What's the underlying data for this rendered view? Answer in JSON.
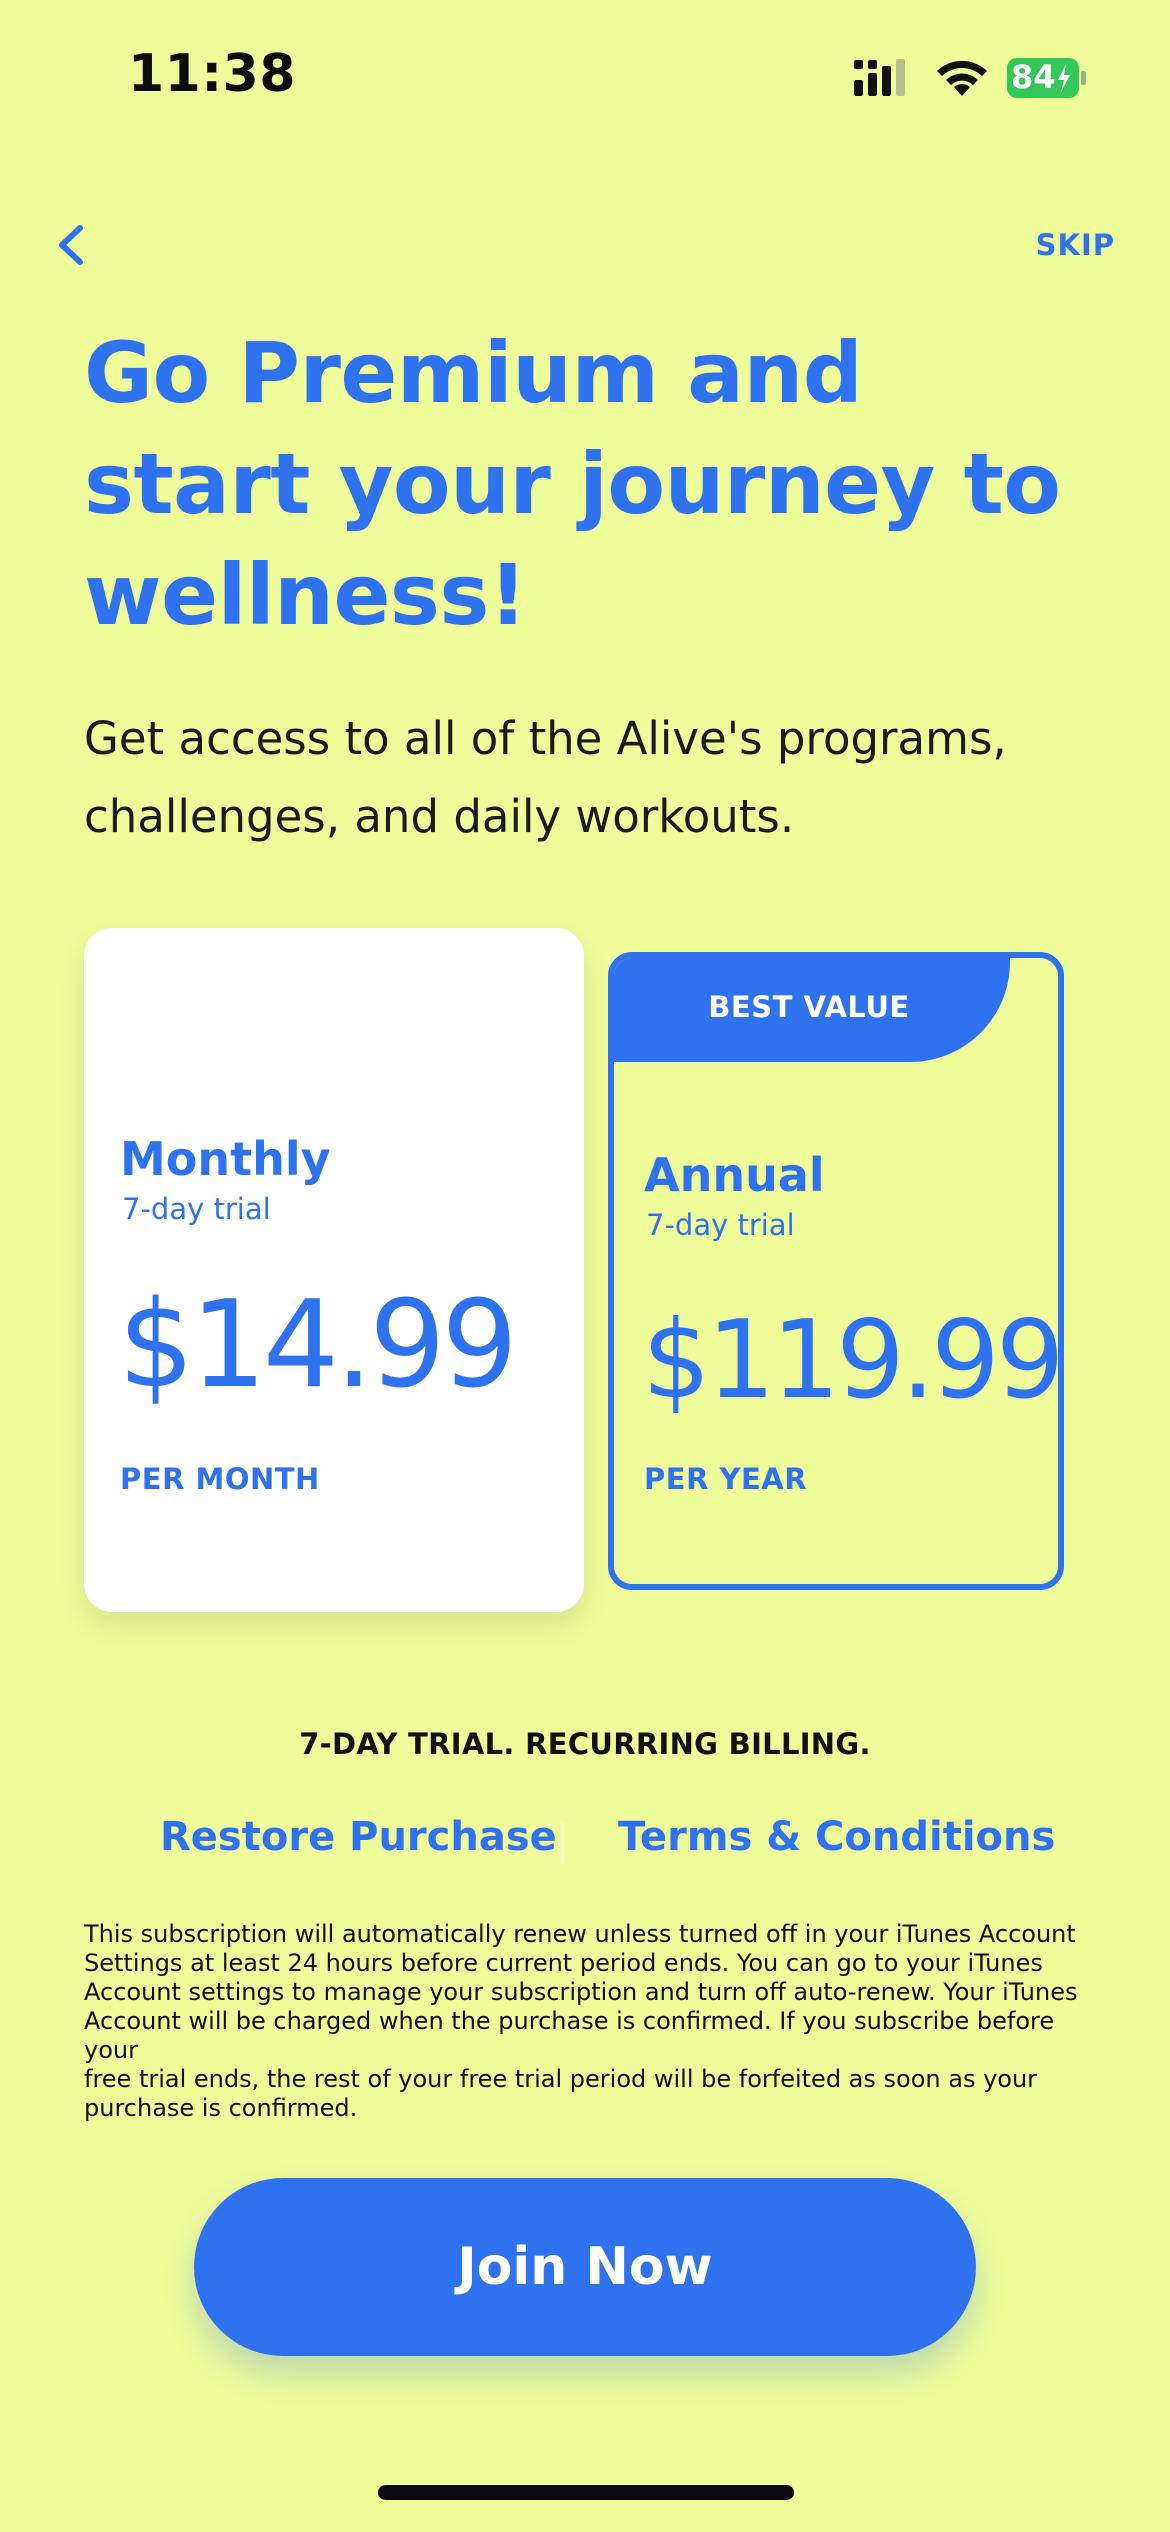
{
  "status_bar": {
    "time": "11:38",
    "battery_level": "84"
  },
  "nav": {
    "skip_label": "SKIP"
  },
  "headline_lines": [
    "Go Premium and",
    "start your journey to",
    "wellness!"
  ],
  "subtext_lines": [
    "Get access to all of the Alive's programs,",
    "challenges, and daily workouts."
  ],
  "plans": {
    "monthly": {
      "name": "Monthly",
      "trial": "7-day trial",
      "price": "$14.99",
      "period": "PER MONTH"
    },
    "annual": {
      "badge": "BEST VALUE",
      "name": "Annual",
      "trial": "7-day trial",
      "price": "$119.99",
      "period": "PER YEAR"
    }
  },
  "billing_note": "7-DAY TRIAL. RECURRING BILLING.",
  "links": {
    "restore": "Restore Purchase",
    "terms": "Terms & Conditions"
  },
  "legal_lines": [
    "This subscription will automatically renew unless turned off in your iTunes Account",
    "Settings at least 24 hours before current period ends. You can go to your iTunes",
    "Account settings to manage your subscription and turn off auto-renew. Your iTunes",
    "Account will be charged when the purchase is confirmed. If you subscribe before your",
    "free trial ends, the rest of your free trial period will be forfeited as soon as your",
    "purchase is confirmed."
  ],
  "cta_label": "Join Now",
  "colors": {
    "background": "#eefc9a",
    "accent": "#2f72ef",
    "battery": "#34c759"
  },
  "icons": [
    "signal-icon",
    "wifi-icon",
    "battery-icon",
    "back-chevron-icon"
  ]
}
